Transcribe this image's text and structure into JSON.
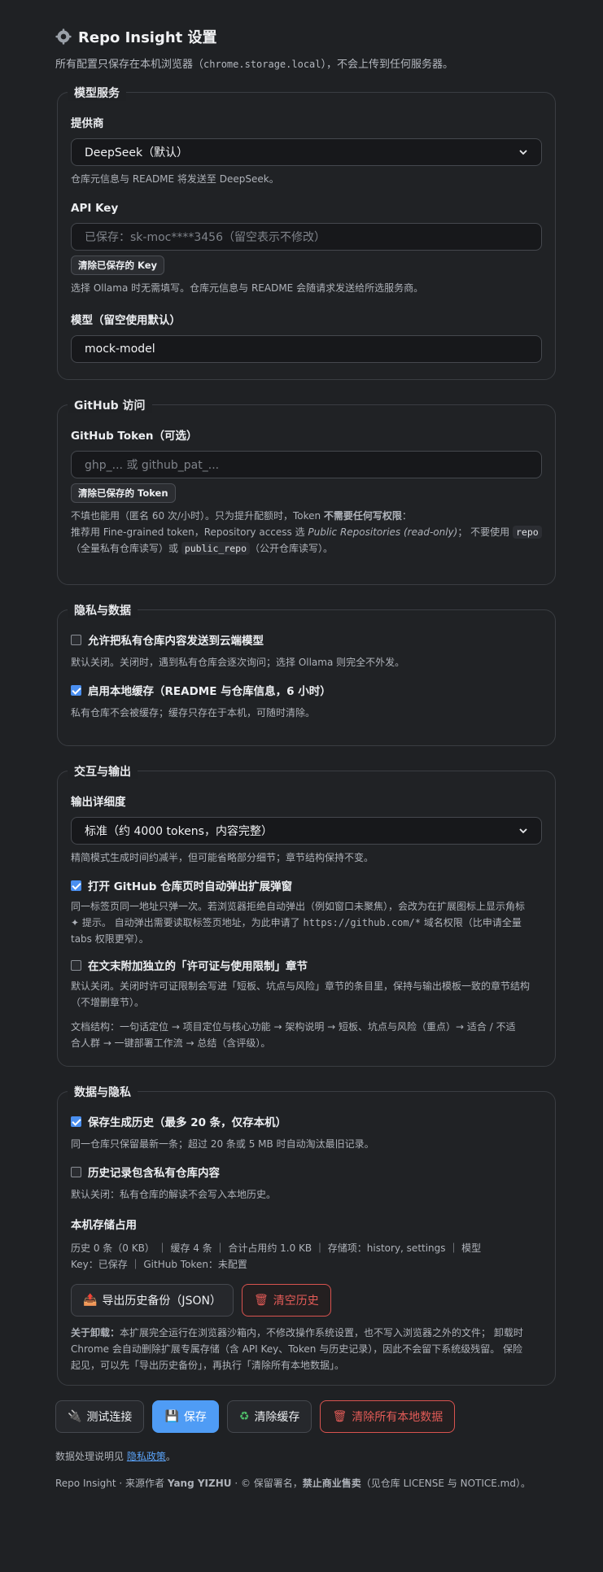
{
  "header": {
    "title": "Repo Insight 设置",
    "subtitle_pre": "所有配置只保存在本机浏览器（",
    "subtitle_code": "chrome.storage.local",
    "subtitle_post": "），不会上传到任何服务器。"
  },
  "model_service": {
    "legend": "模型服务",
    "provider_label": "提供商",
    "provider_value": "DeepSeek（默认）",
    "provider_help": "仓库元信息与 README 将发送至 DeepSeek。",
    "apikey_label": "API Key",
    "apikey_placeholder": "已保存：sk-moc****3456（留空表示不修改）",
    "clear_key_button": "清除已保存的 Key",
    "apikey_help": "选择 Ollama 时无需填写。仓库元信息与 README 会随请求发送给所选服务商。",
    "model_label": "模型（留空使用默认）",
    "model_value": "mock-model"
  },
  "github": {
    "legend": "GitHub 访问",
    "token_label": "GitHub Token（可选）",
    "token_placeholder": "ghp_... 或 github_pat_...",
    "clear_token_button": "清除已保存的 Token",
    "help_line1_pre": "不填也能用（匿名 60 次/小时）。只为提升配额时，Token ",
    "help_line1_bold": "不需要任何写权限",
    "help_line1_post": "：",
    "help_line2_pre": "推荐用 Fine-grained token，Repository access 选 ",
    "help_line2_italic": "Public Repositories (read-only)",
    "help_line2_mid": "；  不要使用 ",
    "help_code_repo": "repo",
    "help_line3_pre": "（全量私有仓库读写）或 ",
    "help_code_public": "public_repo",
    "help_line3_post": "（公开仓库读写）。"
  },
  "privacy": {
    "legend": "隐私与数据",
    "allow_private_label": "允许把私有仓库内容发送到云端模型",
    "allow_private_checked": false,
    "allow_private_help": "默认关闭。关闭时，遇到私有仓库会逐次询问；选择 Ollama 则完全不外发。",
    "cache_label": "启用本地缓存（README 与仓库信息，6 小时）",
    "cache_checked": true,
    "cache_help": "私有仓库不会被缓存；缓存只存在于本机，可随时清除。"
  },
  "interaction": {
    "legend": "交互与输出",
    "verbosity_label": "输出详细度",
    "verbosity_value": "标准（约 4000 tokens，内容完整）",
    "verbosity_help": "精简模式生成时间约减半，但可能省略部分细节；章节结构保持不变。",
    "auto_popup_label": "打开 GitHub 仓库页时自动弹出扩展弹窗",
    "auto_popup_checked": true,
    "auto_popup_help_1": "同一标签页同一地址只弹一次。若浏览器拒绝自动弹出（例如窗口未聚焦），会改为在扩展图标上显示角标",
    "auto_popup_help_2": "✦ 提示。 自动弹出需要读取标签页地址，为此申请了 ",
    "auto_popup_help_code": "https://github.com/*",
    "auto_popup_help_3": " 域名权限（比申请全量",
    "auto_popup_help_4": "tabs 权限更窄）。",
    "license_label": "在文末附加独立的「许可证与使用限制」章节",
    "license_checked": false,
    "license_help_1": "默认关闭。关闭时许可证限制会写进「短板、坑点与风险」章节的条目里，保持与输出模板一致的章节结构",
    "license_help_2": "（不增删章节）。",
    "structure_help_1": "文档结构：一句话定位 → 项目定位与核心功能 → 架构说明 → 短板、坑点与风险（重点）→ 适合 / 不适",
    "structure_help_2": "合人群 → 一键部署工作流 → 总结（含评级）。"
  },
  "data_privacy": {
    "legend": "数据与隐私",
    "save_history_label": "保存生成历史（最多 20 条，仅存本机）",
    "save_history_checked": true,
    "save_history_help": "同一仓库只保留最新一条；超过 20 条或 5 MB 时自动淘汰最旧记录。",
    "history_private_label": "历史记录包含私有仓库内容",
    "history_private_checked": false,
    "history_private_help": "默认关闭：私有仓库的解读不会写入本地历史。",
    "storage_label": "本机存储占用",
    "stats_line1": "历史 0 条（0 KB）  ｜  缓存 4 条  ｜  合计占用约 1.0 KB  ｜  存储项：history, settings  ｜  模型",
    "stats_line2": "Key：已保存  ｜  GitHub Token：未配置",
    "export_button": "导出历史备份（JSON）",
    "clear_history_button": "清空历史",
    "uninstall_bold": "关于卸载：",
    "uninstall_1": "本扩展完全运行在浏览器沙箱内，不修改操作系统设置，也不写入浏览器之外的文件；  卸载时",
    "uninstall_2": "Chrome 会自动删除扩展专属存储（含 API Key、Token 与历史记录），因此不会留下系统级残留。 保险",
    "uninstall_3": "起见，可以先「导出历史备份」，再执行「清除所有本地数据」。"
  },
  "actions": {
    "test": "测试连接",
    "save": "保存",
    "clear_cache": "清除缓存",
    "clear_all": "清除所有本地数据"
  },
  "footer": {
    "policy_pre": "数据处理说明见 ",
    "policy_link": "隐私政策",
    "policy_post": "。",
    "credit_1": "Repo Insight · 来源作者 ",
    "credit_author": "Yang YIZHU",
    "credit_2": " · © 保留署名，",
    "credit_bold": "禁止商业售卖",
    "credit_3": "（见仓库 LICENSE 与 NOTICE.md）。"
  },
  "icons": {
    "gear": "gear-icon",
    "plug": "plug-icon",
    "floppy": "floppy-icon",
    "recycle": "recycle-icon",
    "trash": "trash-icon",
    "export": "export-icon"
  },
  "colors": {
    "background": "#1f2124",
    "accent": "#4f9cf5",
    "danger": "#e35b57"
  }
}
